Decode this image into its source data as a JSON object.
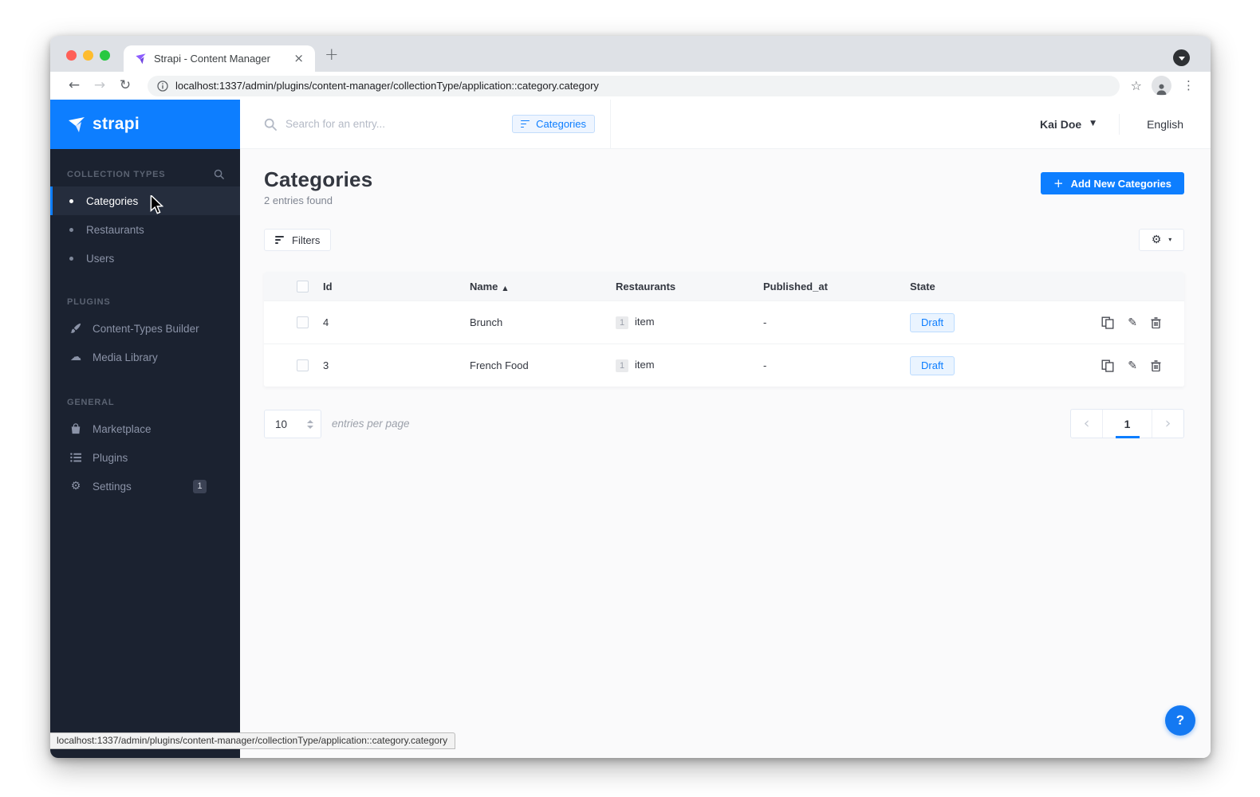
{
  "colors": {
    "accent": "#0d7eff",
    "sidebar_bg": "#1b2230",
    "draft_text": "#0d7eff",
    "draft_bg": "#eaf4ff",
    "draft_border": "#bcdcff"
  },
  "browser": {
    "tab_title": "Strapi - Content Manager",
    "url": "localhost:1337/admin/plugins/content-manager/collectionType/application::category.category",
    "status_url": "localhost:1337/admin/plugins/content-manager/collectionType/application::category.category"
  },
  "icons": {
    "close_tab": "×",
    "new_tab": "+",
    "back": "←",
    "forward": "→",
    "reload": "↻",
    "star": "☆",
    "overflow": "⋮",
    "caret_down": "▾",
    "sort_asc": "▲",
    "gear": "⚙",
    "pencil": "✎",
    "chevron_left": "‹",
    "chevron_right": "›",
    "cloud": "☁",
    "plus": "+"
  },
  "sidebar": {
    "logo_text": "strapi",
    "sections": [
      {
        "label": "COLLECTION TYPES",
        "items": [
          {
            "label": "Categories"
          },
          {
            "label": "Restaurants"
          },
          {
            "label": "Users"
          }
        ]
      },
      {
        "label": "PLUGINS",
        "items": [
          {
            "label": "Content-Types Builder"
          },
          {
            "label": "Media Library"
          }
        ]
      },
      {
        "label": "GENERAL",
        "items": [
          {
            "label": "Marketplace"
          },
          {
            "label": "Plugins"
          },
          {
            "label": "Settings",
            "badge": "1"
          }
        ]
      }
    ]
  },
  "topbar": {
    "search_placeholder": "Search for an entry...",
    "filter_chip": "Categories",
    "user_name": "Kai Doe",
    "locale": "English"
  },
  "main": {
    "title": "Categories",
    "subtitle": "2 entries found",
    "add_button": "Add New Categories",
    "filters_button": "Filters",
    "table": {
      "columns": [
        "Id",
        "Name",
        "Restaurants",
        "Published_at",
        "State"
      ],
      "sorted_column": "Name",
      "rows": [
        {
          "id": "4",
          "name": "Brunch",
          "restaurants_count": "1",
          "restaurants_label": "item",
          "published_at": "-",
          "state": "Draft"
        },
        {
          "id": "3",
          "name": "French Food",
          "restaurants_count": "1",
          "restaurants_label": "item",
          "published_at": "-",
          "state": "Draft"
        }
      ]
    },
    "pagination": {
      "per_page": "10",
      "per_page_label": "entries per page",
      "current_page": "1"
    }
  },
  "help": {
    "label": "?"
  }
}
